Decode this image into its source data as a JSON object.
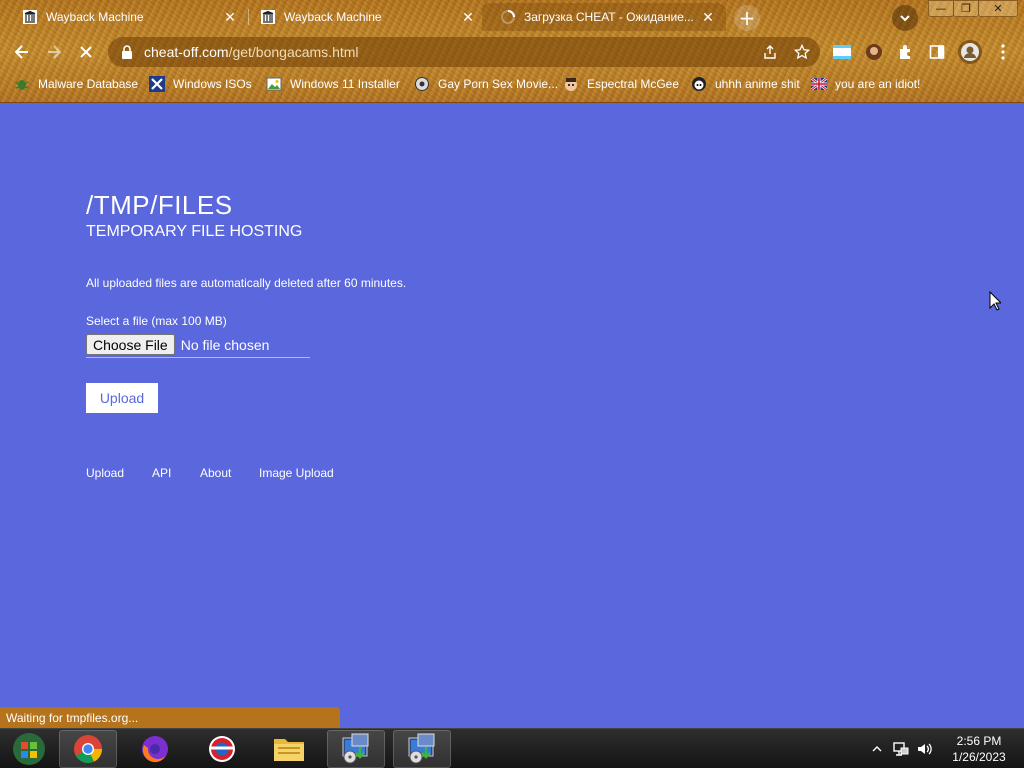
{
  "browser": {
    "tabs": [
      {
        "title": "Wayback Machine",
        "favicon": "archive-icon"
      },
      {
        "title": "Wayback Machine",
        "favicon": "archive-icon"
      },
      {
        "title": "Загрузка CHEAT - Ожидание...",
        "favicon": "loading-icon"
      }
    ],
    "url_host": "cheat-off.com",
    "url_path": "/get/bongacams.html",
    "bookmarks": [
      {
        "label": "Malware Database",
        "icon": "bug-icon"
      },
      {
        "label": "Windows ISOs",
        "icon": "x-icon"
      },
      {
        "label": "Windows 11 Installer",
        "icon": "image-icon"
      },
      {
        "label": "Gay Porn Sex Movie...",
        "icon": "gear-icon"
      },
      {
        "label": "Espectral McGee",
        "icon": "face-icon"
      },
      {
        "label": "uhhh anime shit",
        "icon": "anime-icon"
      },
      {
        "label": "you are an idiot!",
        "icon": "flag-icon"
      }
    ],
    "status_text": "Waiting for tmpfiles.org..."
  },
  "page": {
    "title": "/TMP/FILES",
    "subtitle": "TEMPORARY FILE HOSTING",
    "notice": "All uploaded files are automatically deleted after 60 minutes.",
    "file_label": "Select a file (max 100 MB)",
    "choose_file": "Choose File",
    "no_file": "No file chosen",
    "upload_button": "Upload",
    "footer_links": [
      "Upload",
      "API",
      "About",
      "Image Upload"
    ],
    "background_color": "#5a67dd"
  },
  "taskbar": {
    "apps": [
      "start-orb",
      "chrome",
      "firefox",
      "opera",
      "file-explorer",
      "installer",
      "installer"
    ],
    "time": "2:56 PM",
    "date": "1/26/2023"
  }
}
